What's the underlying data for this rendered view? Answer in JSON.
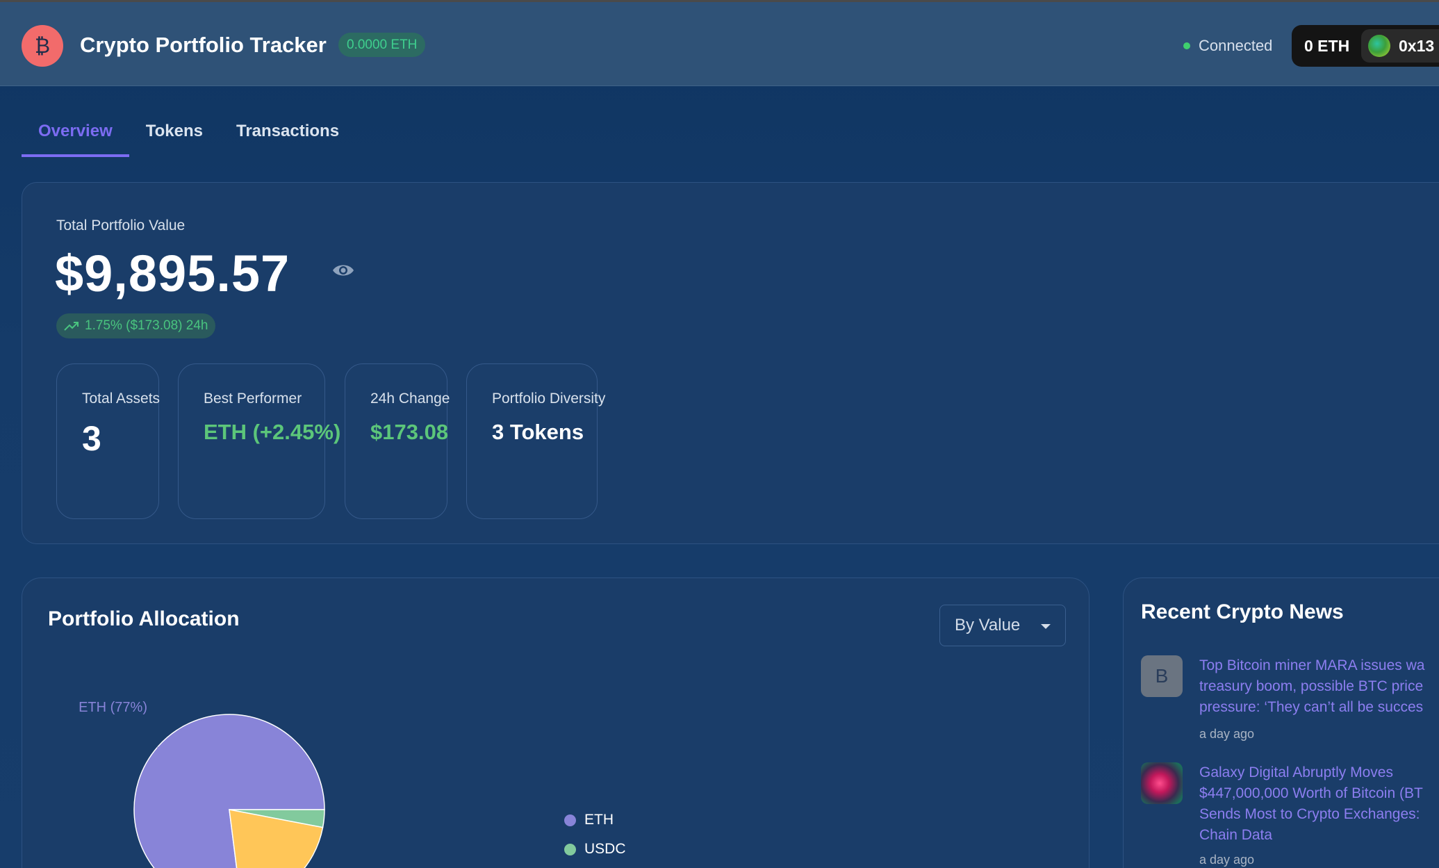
{
  "header": {
    "logo_glyph": "₿",
    "title": "Crypto Portfolio Tracker",
    "eth_badge": "0.0000 ETH",
    "connection_status": "Connected",
    "wallet_balance": "0 ETH",
    "wallet_address": "0x13"
  },
  "tabs": [
    {
      "label": "Overview",
      "active": true
    },
    {
      "label": "Tokens",
      "active": false
    },
    {
      "label": "Transactions",
      "active": false
    }
  ],
  "summary": {
    "label": "Total Portfolio Value",
    "value": "$9,895.57",
    "change": "1.75% ($173.08) 24h",
    "stats": [
      {
        "label": "Total Assets",
        "value": "3"
      },
      {
        "label": "Best Performer",
        "value": "ETH (+2.45%)"
      },
      {
        "label": "24h Change",
        "value": "$173.08"
      },
      {
        "label": "Portfolio Diversity",
        "value": "3 Tokens"
      }
    ]
  },
  "allocation": {
    "title": "Portfolio Allocation",
    "sort_select": "By Value",
    "legend": [
      {
        "label": "ETH",
        "color": "#8884d8"
      },
      {
        "label": "USDC",
        "color": "#82ca9d"
      },
      {
        "label": "",
        "color": "#ffc658"
      }
    ]
  },
  "chart_data": {
    "type": "pie",
    "title": "Portfolio Allocation",
    "slices": [
      {
        "label": "ETH",
        "percent": 77,
        "color": "#8884d8",
        "data_label": "ETH (77%)"
      },
      {
        "label": "USDC",
        "percent": 3,
        "color": "#82ca9d"
      },
      {
        "label": "",
        "percent": 20,
        "color": "#ffc658"
      }
    ],
    "legend_position": "right"
  },
  "news": {
    "title": "Recent Crypto News",
    "items": [
      {
        "thumb_letter": "B",
        "headline": "Top Bitcoin miner MARA issues wa\ntreasury boom, possible BTC price\npressure: ‘They can’t all be succes",
        "time": "a day ago"
      },
      {
        "thumb_letter": "",
        "headline": "Galaxy Digital Abruptly Moves\n$447,000,000 Worth of Bitcoin (BT\nSends Most to Crypto Exchanges:\nChain Data",
        "time": "a day ago"
      }
    ]
  },
  "colors": {
    "accent": "#7c6cf2",
    "positive": "#5cc67a",
    "logo": "#f26b6b",
    "background": "#0f3562"
  }
}
